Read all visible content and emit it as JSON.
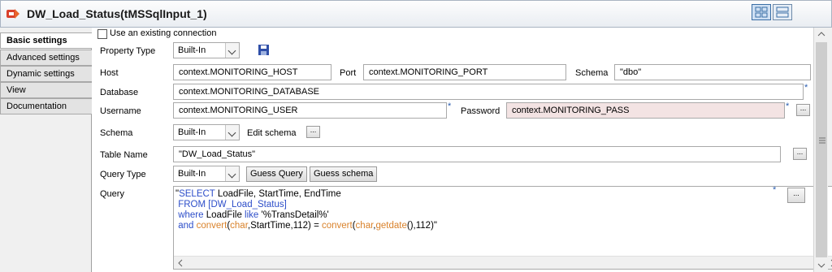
{
  "window": {
    "title": "DW_Load_Status(tMSSqlInput_1)"
  },
  "sidebar": {
    "tabs": [
      {
        "label": "Basic settings"
      },
      {
        "label": "Advanced settings"
      },
      {
        "label": "Dynamic settings"
      },
      {
        "label": "View"
      },
      {
        "label": "Documentation"
      }
    ]
  },
  "form": {
    "use_existing_connection": {
      "label": "Use an existing connection",
      "checked": false
    },
    "property_type": {
      "label": "Property Type",
      "value": "Built-In"
    },
    "host": {
      "label": "Host",
      "value": "context.MONITORING_HOST"
    },
    "port": {
      "label": "Port",
      "value": "context.MONITORING_PORT"
    },
    "schema_db": {
      "label": "Schema",
      "value": "\"dbo\""
    },
    "database": {
      "label": "Database",
      "value": "context.MONITORING_DATABASE"
    },
    "username": {
      "label": "Username",
      "value": "context.MONITORING_USER"
    },
    "password": {
      "label": "Password",
      "value": "context.MONITORING_PASS"
    },
    "schema": {
      "label": "Schema",
      "value": "Built-In",
      "edit_label": "Edit schema"
    },
    "table_name": {
      "label": "Table Name",
      "value": "\"DW_Load_Status\""
    },
    "query_type": {
      "label": "Query Type",
      "value": "Built-In",
      "guess_query": "Guess Query",
      "guess_schema": "Guess schema"
    },
    "query": {
      "label": "Query",
      "lines": [
        "\"SELECT LoadFile, StartTime, EndTime",
        " FROM [DW_Load_Status]",
        " where LoadFile like '%TransDetail%'",
        " and convert(char,StartTime,112) = convert(char,getdate(),112)\""
      ]
    },
    "required_marker": "*",
    "more_button": "..."
  }
}
